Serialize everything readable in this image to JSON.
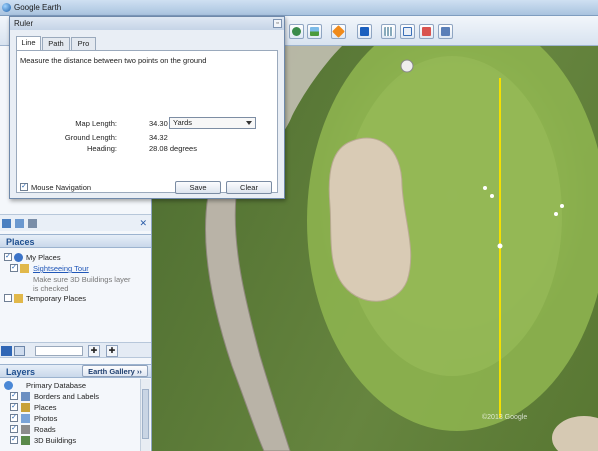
{
  "app": {
    "title": "Google Earth"
  },
  "ruler": {
    "title": "Ruler",
    "tabs": [
      "Line",
      "Path",
      "Pro"
    ],
    "instruction": "Measure the distance between two points on the ground",
    "map_length_label": "Map Length:",
    "map_length_value": "34.30",
    "units_selected": "Yards",
    "ground_length_label": "Ground Length:",
    "ground_length_value": "34.32",
    "heading_label": "Heading:",
    "heading_value": "28.08 degrees",
    "mouse_nav_label": "Mouse Navigation",
    "mouse_nav_checked": true,
    "save_label": "Save",
    "clear_label": "Clear"
  },
  "places": {
    "header": "Places",
    "items": [
      {
        "label": "My Places"
      },
      {
        "label": "Sightseeing Tour",
        "note": "Make sure 3D Buildings layer is checked"
      },
      {
        "label": "Temporary Places"
      }
    ]
  },
  "layers": {
    "header": "Layers",
    "earth_gallery_label": "Earth Gallery",
    "items": [
      {
        "label": "Primary Database"
      },
      {
        "label": "Borders and Labels"
      },
      {
        "label": "Places"
      },
      {
        "label": "Photos"
      },
      {
        "label": "Roads"
      },
      {
        "label": "3D Buildings"
      }
    ]
  },
  "map": {
    "copyright": "©2013 Google",
    "measure_line_color": "#f5e000"
  },
  "icons": [
    "globe-icon",
    "close-icon",
    "search-icon",
    "print-icon",
    "email-icon",
    "folder-icon",
    "sun-icon",
    "planet-icon",
    "ruler-icon"
  ]
}
